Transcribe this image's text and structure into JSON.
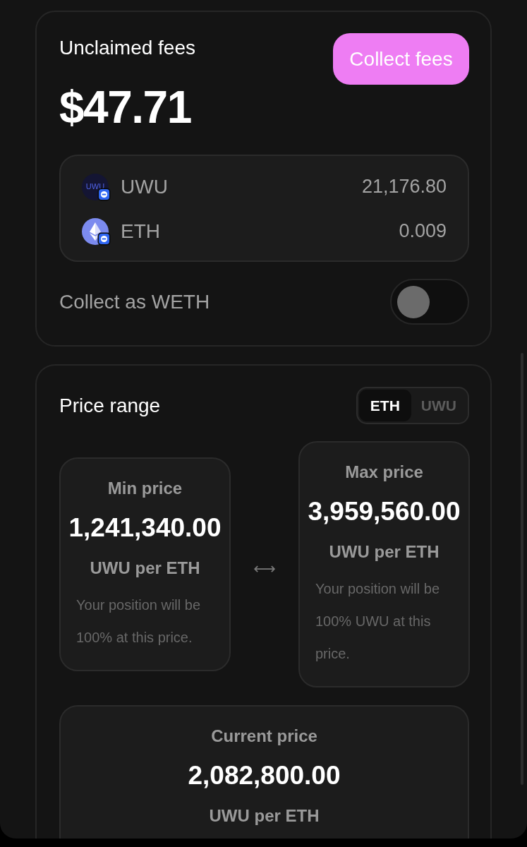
{
  "fees_card": {
    "title": "Unclaimed fees",
    "amount": "$47.71",
    "collect_button": "Collect fees",
    "tokens": [
      {
        "kind": "uwu",
        "logo_text": "UWU",
        "symbol": "UWU",
        "amount": "21,176.80"
      },
      {
        "kind": "eth",
        "symbol": "ETH",
        "amount": "0.009"
      }
    ],
    "collect_as_weth": {
      "label": "Collect as WETH",
      "on": false
    }
  },
  "price_range": {
    "title": "Price range",
    "currency_tabs": [
      {
        "label": "ETH",
        "selected": true
      },
      {
        "label": "UWU",
        "selected": false
      }
    ],
    "min": {
      "label": "Min price",
      "value": "1,241,340.00",
      "unit": "UWU per ETH",
      "note": "Your position will be 100% at this price."
    },
    "separator": "⟷",
    "max": {
      "label": "Max price",
      "value": "3,959,560.00",
      "unit": "UWU per ETH",
      "note": "Your position will be 100% UWU at this price."
    },
    "current": {
      "label": "Current price",
      "value": "2,082,800.00",
      "unit": "UWU per ETH"
    }
  }
}
